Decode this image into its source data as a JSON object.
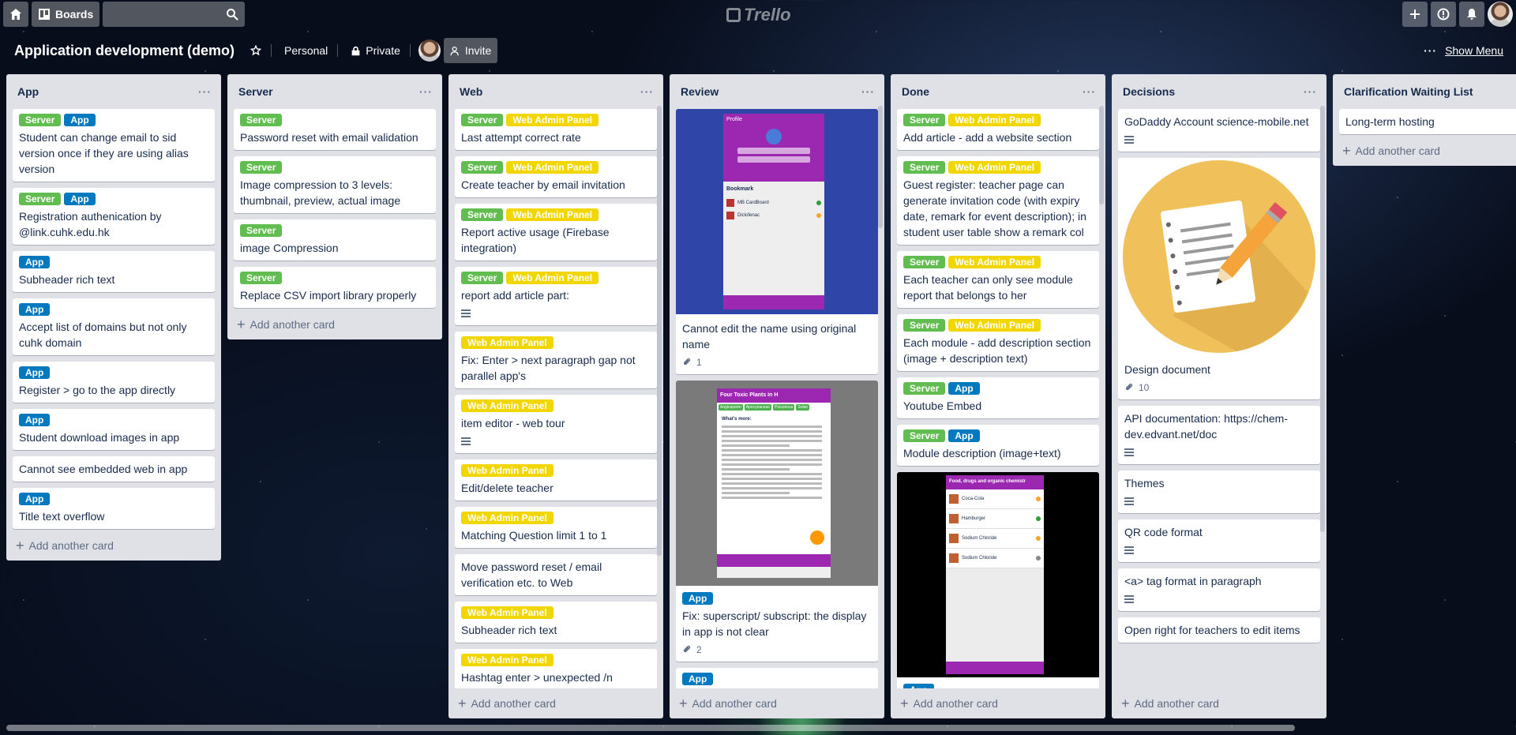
{
  "header": {
    "boards_label": "Boards",
    "search_value": "",
    "logo_text": "Trello"
  },
  "board": {
    "title": "Application development (demo)",
    "team": "Personal",
    "visibility": "Private",
    "invite_label": "Invite",
    "show_menu_label": "Show Menu"
  },
  "colors": {
    "green": "#61bd4f",
    "yellow": "#f2d600",
    "blue": "#0079bf",
    "list_bg": "#dfe1e6"
  },
  "add_card_label": "Add another card",
  "lists": [
    {
      "name": "App",
      "cards": [
        {
          "labels": [
            {
              "text": "Server",
              "color": "green"
            },
            {
              "text": "App",
              "color": "blue"
            }
          ],
          "title": "Student can change email to sid version once if they are using alias version"
        },
        {
          "labels": [
            {
              "text": "Server",
              "color": "green"
            },
            {
              "text": "App",
              "color": "blue"
            }
          ],
          "title": "Registration authenication by @link.cuhk.edu.hk"
        },
        {
          "labels": [
            {
              "text": "App",
              "color": "blue"
            }
          ],
          "title": "Subheader rich text"
        },
        {
          "labels": [
            {
              "text": "App",
              "color": "blue"
            }
          ],
          "title": "Accept list of domains but not only cuhk domain"
        },
        {
          "labels": [
            {
              "text": "App",
              "color": "blue"
            }
          ],
          "title": "Register > go to the app directly"
        },
        {
          "labels": [
            {
              "text": "App",
              "color": "blue"
            }
          ],
          "title": "Student download images in app"
        },
        {
          "labels": [],
          "title": "Cannot see embedded web in app"
        },
        {
          "labels": [
            {
              "text": "App",
              "color": "blue"
            }
          ],
          "title": "Title text overflow"
        }
      ]
    },
    {
      "name": "Server",
      "cards": [
        {
          "labels": [
            {
              "text": "Server",
              "color": "green"
            }
          ],
          "title": "Password reset with email validation"
        },
        {
          "labels": [
            {
              "text": "Server",
              "color": "green"
            }
          ],
          "title": "Image compression to 3 levels: thumbnail, preview, actual image"
        },
        {
          "labels": [
            {
              "text": "Server",
              "color": "green"
            }
          ],
          "title": "image Compression"
        },
        {
          "labels": [
            {
              "text": "Server",
              "color": "green"
            }
          ],
          "title": "Replace CSV import library properly"
        }
      ]
    },
    {
      "name": "Web",
      "cards": [
        {
          "labels": [
            {
              "text": "Server",
              "color": "green"
            },
            {
              "text": "Web Admin Panel",
              "color": "yellow"
            }
          ],
          "title": "Last attempt correct rate"
        },
        {
          "labels": [
            {
              "text": "Server",
              "color": "green"
            },
            {
              "text": "Web Admin Panel",
              "color": "yellow"
            }
          ],
          "title": "Create teacher by email invitation"
        },
        {
          "labels": [
            {
              "text": "Server",
              "color": "green"
            },
            {
              "text": "Web Admin Panel",
              "color": "yellow"
            }
          ],
          "title": "Report active usage (Firebase integration)"
        },
        {
          "labels": [
            {
              "text": "Server",
              "color": "green"
            },
            {
              "text": "Web Admin Panel",
              "color": "yellow"
            }
          ],
          "title": "report add article part:",
          "has_description": true
        },
        {
          "labels": [
            {
              "text": "Web Admin Panel",
              "color": "yellow"
            }
          ],
          "title": "Fix: Enter > next paragraph gap not parallel app's"
        },
        {
          "labels": [
            {
              "text": "Web Admin Panel",
              "color": "yellow"
            }
          ],
          "title": "item editor - web tour",
          "has_description": true
        },
        {
          "labels": [
            {
              "text": "Web Admin Panel",
              "color": "yellow"
            }
          ],
          "title": "Edit/delete teacher"
        },
        {
          "labels": [
            {
              "text": "Web Admin Panel",
              "color": "yellow"
            }
          ],
          "title": "Matching Question limit 1 to 1"
        },
        {
          "labels": [],
          "title": "Move password reset / email verification etc. to Web"
        },
        {
          "labels": [
            {
              "text": "Web Admin Panel",
              "color": "yellow"
            }
          ],
          "title": "Subheader rich text"
        },
        {
          "labels": [
            {
              "text": "Web Admin Panel",
              "color": "yellow"
            }
          ],
          "title": "Hashtag enter > unexpected /n"
        }
      ]
    },
    {
      "name": "Review",
      "cards": [
        {
          "cover": "phone-profile",
          "labels": [],
          "title": "Cannot edit the name using original name",
          "attachments": "1"
        },
        {
          "cover": "phone-article",
          "labels": [
            {
              "text": "App",
              "color": "blue"
            }
          ],
          "title": "Fix: superscript/ subscript: the display in app is not clear",
          "attachments": "2"
        },
        {
          "labels": [
            {
              "text": "App",
              "color": "blue"
            }
          ],
          "title": ""
        }
      ],
      "phone_profile": {
        "header": "Profile",
        "section": "Bookmark",
        "items": [
          "MB CardBoard",
          "Diclofenac"
        ]
      },
      "phone_article": {
        "header": "Four Toxic Plants in H",
        "tabs": [
          "Angiosperm",
          "Apocynaceae",
          "Poisonous",
          "Solan"
        ],
        "heading": "What's more:"
      }
    },
    {
      "name": "Done",
      "cards": [
        {
          "labels": [
            {
              "text": "Server",
              "color": "green"
            },
            {
              "text": "Web Admin Panel",
              "color": "yellow"
            }
          ],
          "title": "Add article - add a website section"
        },
        {
          "labels": [
            {
              "text": "Server",
              "color": "green"
            },
            {
              "text": "Web Admin Panel",
              "color": "yellow"
            }
          ],
          "title": "Guest register: teacher page can generate invitation code (with expiry date, remark for event description); in student user table show a remark col"
        },
        {
          "labels": [
            {
              "text": "Server",
              "color": "green"
            },
            {
              "text": "Web Admin Panel",
              "color": "yellow"
            }
          ],
          "title": "Each teacher can only see module report that belongs to her"
        },
        {
          "labels": [
            {
              "text": "Server",
              "color": "green"
            },
            {
              "text": "Web Admin Panel",
              "color": "yellow"
            }
          ],
          "title": "Each module - add description section (image + description text)"
        },
        {
          "labels": [
            {
              "text": "Server",
              "color": "green"
            },
            {
              "text": "App",
              "color": "blue"
            }
          ],
          "title": "Youtube Embed"
        },
        {
          "labels": [
            {
              "text": "Server",
              "color": "green"
            },
            {
              "text": "App",
              "color": "blue"
            }
          ],
          "title": "Module description (image+text)"
        },
        {
          "cover": "phone-food",
          "labels": [
            {
              "text": "App",
              "color": "blue"
            }
          ],
          "title": ""
        }
      ],
      "phone_food": {
        "header": "Food, drugs and organic chemistr",
        "items": [
          "Coca-Cola",
          "Hamburger",
          "Sodium Chloride",
          "Sodium Chloride"
        ]
      }
    },
    {
      "name": "Decisions",
      "cards": [
        {
          "labels": [],
          "title": "GoDaddy Account science-mobile.net",
          "has_description": true
        },
        {
          "cover": "notepad",
          "labels": [],
          "title": "Design document",
          "attachments": "10"
        },
        {
          "labels": [],
          "title": "API documentation: https://chem-dev.edvant.net/doc",
          "has_description": true
        },
        {
          "labels": [],
          "title": "Themes",
          "has_description": true
        },
        {
          "labels": [],
          "title": "QR code format",
          "has_description": true
        },
        {
          "labels": [],
          "title": "<a> tag format in paragraph",
          "has_description": true
        },
        {
          "labels": [],
          "title": "Open right for teachers to edit items"
        }
      ]
    },
    {
      "name": "Clarification Waiting List",
      "cards": [
        {
          "labels": [],
          "title": "Long-term hosting"
        }
      ]
    }
  ]
}
